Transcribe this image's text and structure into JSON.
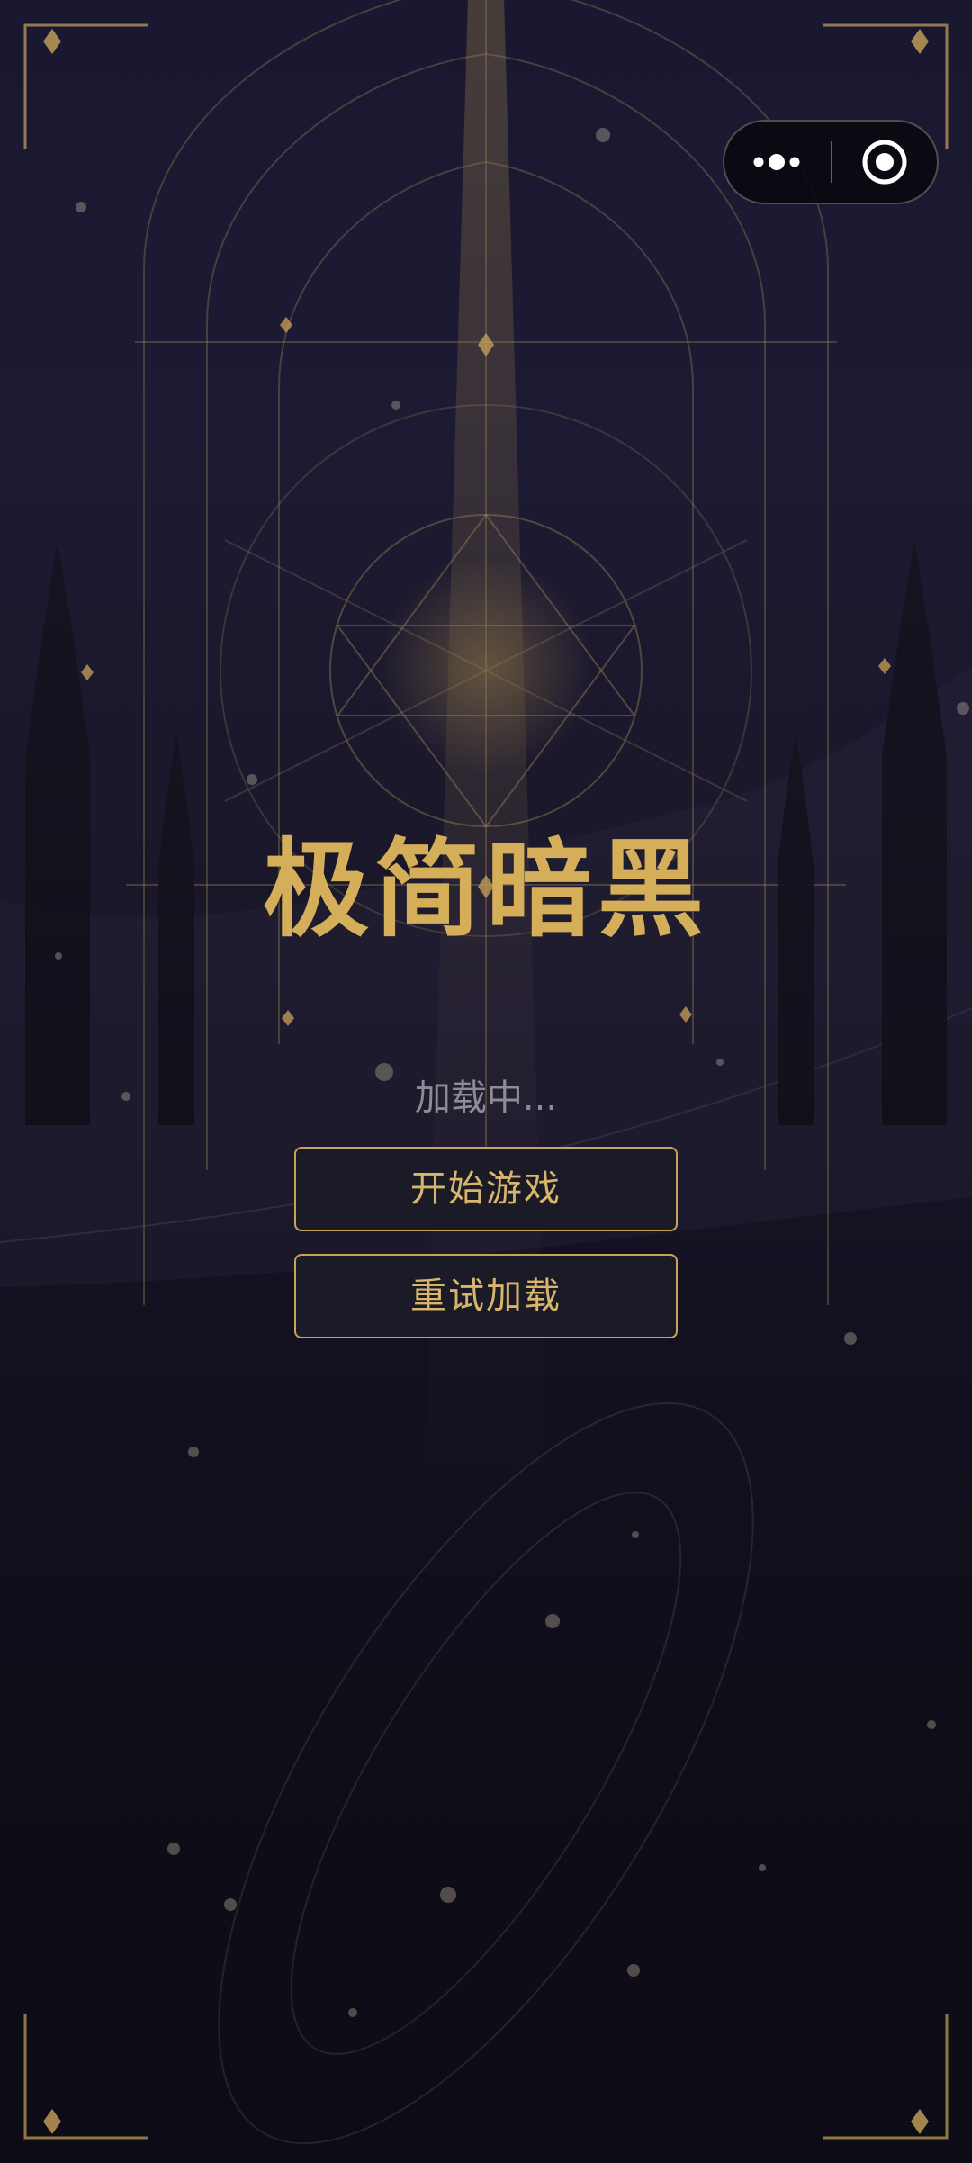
{
  "app": {
    "title": "极简暗黑",
    "status": "加载中..."
  },
  "buttons": {
    "start_label": "开始游戏",
    "retry_label": "重试加载"
  },
  "capsule": {
    "more_icon": "more-dots-icon",
    "close_icon": "target-close-icon"
  },
  "colors": {
    "gold_accent": "#d5ae5a",
    "background_top": "#1d1a33",
    "background_bottom": "#0d0b15",
    "button_bg": "#1b1a27",
    "status_text": "#8e8b95"
  }
}
